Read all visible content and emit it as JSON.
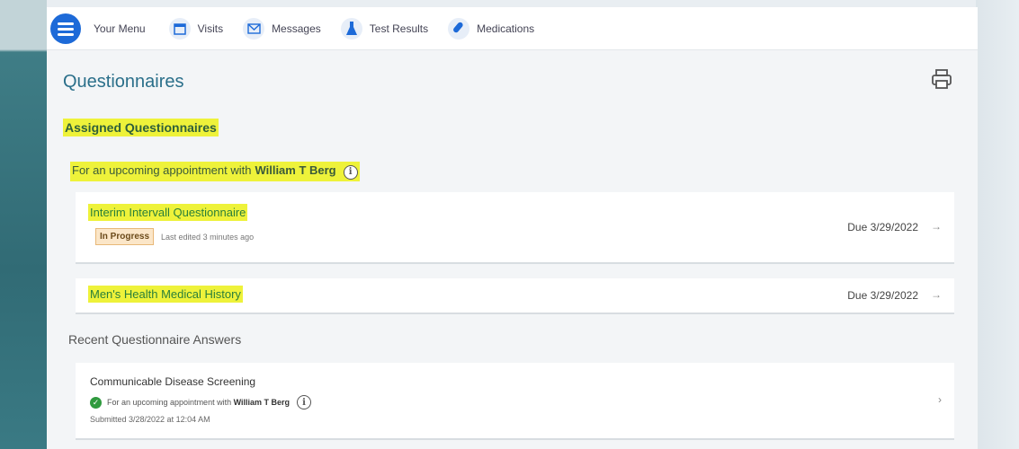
{
  "nav": {
    "menu_label": "Your Menu",
    "items": [
      {
        "label": "Visits",
        "icon": "calendar-icon"
      },
      {
        "label": "Messages",
        "icon": "envelope-icon"
      },
      {
        "label": "Test Results",
        "icon": "flask-icon"
      },
      {
        "label": "Medications",
        "icon": "pill-icon"
      }
    ]
  },
  "page": {
    "title": "Questionnaires",
    "print_icon": "printer-icon"
  },
  "assigned": {
    "title": "Assigned Questionnaires",
    "appointment_prefix": "For an upcoming appointment with",
    "doctor": "William T Berg",
    "info_glyph": "i",
    "items": [
      {
        "title": "Interim Intervall Questionnaire",
        "status": "In Progress",
        "edited": "Last edited 3 minutes ago",
        "due": "Due 3/29/2022",
        "arrow": "→"
      },
      {
        "title": "Men's Health Medical History",
        "due": "Due 3/29/2022",
        "arrow": "→"
      }
    ]
  },
  "recent": {
    "title": "Recent Questionnaire Answers",
    "items": [
      {
        "title": "Communicable Disease Screening",
        "check_glyph": "✓",
        "appointment_prefix": "For an upcoming appointment with",
        "doctor": "William T Berg",
        "info_glyph": "i",
        "submitted": "Submitted 3/28/2022 at 12:04 AM",
        "arrow": "›"
      }
    ]
  },
  "colors": {
    "accent_blue": "#1d6ad8",
    "highlight": "#eef23a",
    "title_teal": "#2a6f8a",
    "badge_bg": "#fbe6c8",
    "success": "#2f9a3e"
  }
}
